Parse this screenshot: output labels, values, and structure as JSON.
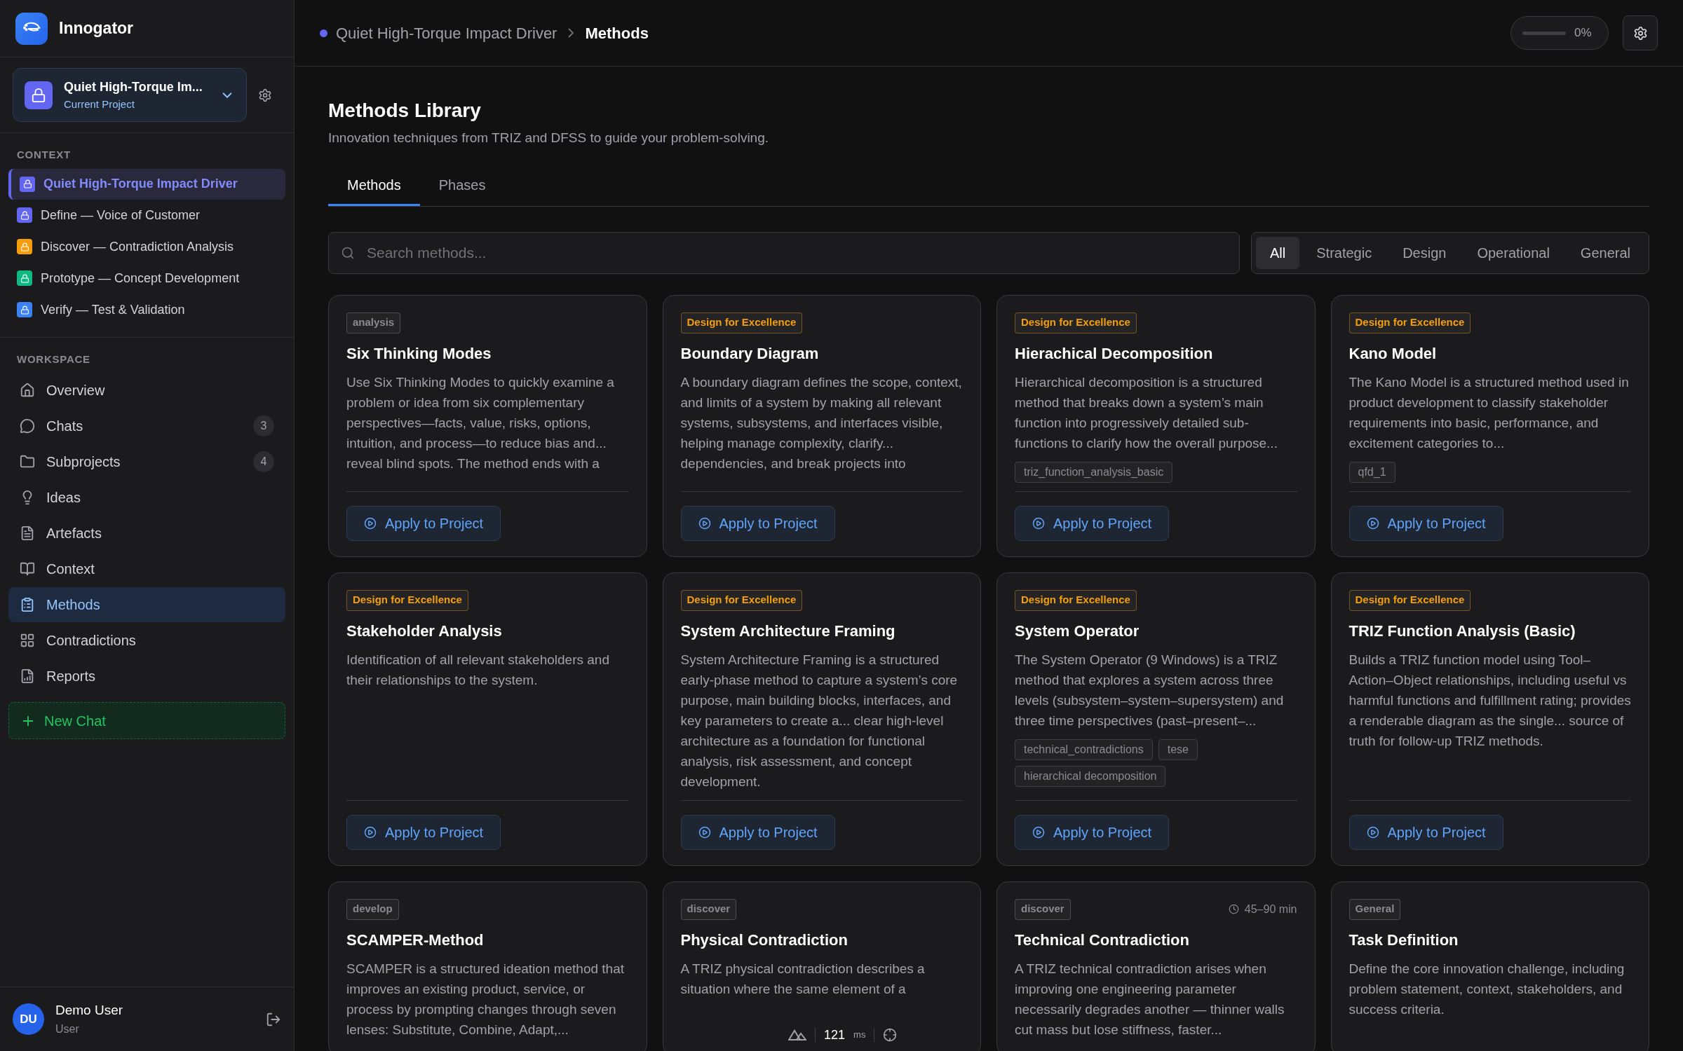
{
  "app": {
    "name": "Innogator"
  },
  "project": {
    "name": "Quiet High-Torque Im...",
    "caption": "Current Project"
  },
  "context": {
    "label": "CONTEXT",
    "items": [
      {
        "label": "Quiet High-Torque Impact Driver",
        "color": "#6366f1",
        "selected": true
      },
      {
        "label": "Define — Voice of Customer",
        "color": "#6366f1",
        "selected": false
      },
      {
        "label": "Discover — Contradiction Analysis",
        "color": "#f59e0b",
        "selected": false
      },
      {
        "label": "Prototype — Concept Development",
        "color": "#10b981",
        "selected": false
      },
      {
        "label": "Verify — Test & Validation",
        "color": "#3b82f6",
        "selected": false
      }
    ]
  },
  "workspace": {
    "label": "WORKSPACE",
    "items": [
      {
        "label": "Overview",
        "selected": false
      },
      {
        "label": "Chats",
        "count": "3",
        "selected": false
      },
      {
        "label": "Subprojects",
        "count": "4",
        "selected": false
      },
      {
        "label": "Ideas",
        "selected": false
      },
      {
        "label": "Artefacts",
        "selected": false
      },
      {
        "label": "Context",
        "selected": false
      },
      {
        "label": "Methods",
        "selected": true
      },
      {
        "label": "Contradictions",
        "selected": false
      },
      {
        "label": "Reports",
        "selected": false
      }
    ]
  },
  "new_chat": "New Chat",
  "user": {
    "initials": "DU",
    "name": "Demo User",
    "role": "User"
  },
  "breadcrumb": {
    "color": "#6366f1",
    "items": [
      "Quiet High-Torque Impact Driver",
      "Methods"
    ]
  },
  "progress": {
    "level": 0,
    "reading": "0%"
  },
  "page": {
    "title": "Methods Library",
    "subtitle": "Innovation techniques from TRIZ and DFSS to guide your problem-solving."
  },
  "tabs": [
    {
      "label": "Methods",
      "selected": true
    },
    {
      "label": "Phases",
      "selected": false
    }
  ],
  "search": {
    "placeholder": "Search methods..."
  },
  "filters": [
    {
      "label": "All",
      "selected": true
    },
    {
      "label": "Strategic",
      "selected": false
    },
    {
      "label": "Design",
      "selected": false
    },
    {
      "label": "Operational",
      "selected": false
    },
    {
      "label": "General",
      "selected": false
    }
  ],
  "methods": [
    {
      "tag": "analysis",
      "color": "#8a8a93",
      "title": "Six Thinking Modes",
      "description": "Use Six Thinking Modes to quickly examine a problem or idea from six complementary perspectives—facts, value, risks, options, intuition, and process—to reduce bias and... reveal blind spots. The method ends with a",
      "button": "Apply to Project"
    },
    {
      "tag": "Design for Excellence",
      "color": "#f59e0b",
      "title": "Boundary Diagram",
      "description": "A boundary diagram defines the scope, context, and limits of a system by making all relevant systems, subsystems, and interfaces visible, helping manage complexity, clarify... dependencies, and break projects into",
      "button": "Apply to Project"
    },
    {
      "tag": "Design for Excellence",
      "color": "#f59e0b",
      "title": "Hierachical Decomposition",
      "description": "Hierarchical decomposition is a structured method that breaks down a system’s main function into progressively detailed sub-functions to clarify how the overall purpose...",
      "keywords": [
        "triz_function_analysis_basic"
      ],
      "button": "Apply to Project"
    },
    {
      "tag": "Design for Excellence",
      "color": "#f59e0b",
      "title": "Kano Model",
      "description": "The Kano Model is a structured method used in product development to classify stakeholder requirements into basic, performance, and excitement categories to...",
      "keywords": [
        "qfd_1"
      ],
      "button": "Apply to Project"
    },
    {
      "tag": "Design for Excellence",
      "color": "#f59e0b",
      "title": "Stakeholder Analysis",
      "description": "Identification of all relevant stakeholders and their relationships to the system.",
      "button": "Apply to Project"
    },
    {
      "tag": "Design for Excellence",
      "color": "#f59e0b",
      "title": "System Architecture Framing",
      "description": "System Architecture Framing is a structured early-phase method to capture a system’s core purpose, main building blocks, interfaces, and key parameters to create a... clear high-level architecture as a foundation for functional analysis, risk assessment, and concept development.",
      "button": "Apply to Project"
    },
    {
      "tag": "Design for Excellence",
      "color": "#f59e0b",
      "title": "System Operator",
      "description": "The System Operator (9 Windows) is a TRIZ method that explores a system across three levels (subsystem–system–supersystem) and three time perspectives (past–present–...",
      "keywords": [
        "technical_contradictions",
        "tese",
        "hierarchical decomposition"
      ],
      "button": "Apply to Project"
    },
    {
      "tag": "Design for Excellence",
      "color": "#f59e0b",
      "title": "TRIZ Function Analysis (Basic)",
      "description": "Builds a TRIZ function model using Tool–Action–Object relationships, including useful vs harmful functions and fulfillment rating; provides a renderable diagram as the single... source of truth for follow-up TRIZ methods.",
      "button": "Apply to Project"
    },
    {
      "tag": "develop",
      "color": "#8a8a93",
      "title": "SCAMPER-Method",
      "description": "SCAMPER is a structured ideation method that improves an existing product, service, or process by prompting changes through seven lenses: Substitute, Combine, Adapt,..."
    },
    {
      "tag": "discover",
      "color": "#8a8a93",
      "title": "Physical Contradiction",
      "description": "A TRIZ physical contradiction describes a situation where the same element of a"
    },
    {
      "tag": "discover",
      "color": "#8a8a93",
      "duration": "45–90 min",
      "title": "Technical Contradiction",
      "description": "A TRIZ technical contradiction arises when improving one engineering parameter necessarily degrades another — thinner walls cut mass but lose stiffness, faster..."
    },
    {
      "tag": "General",
      "color": "#8a8a93",
      "title": "Task Definition",
      "description": "Define the core innovation challenge, including problem statement, context, stakeholders, and success criteria."
    }
  ],
  "timing": {
    "value": "121",
    "unit": "ms"
  }
}
